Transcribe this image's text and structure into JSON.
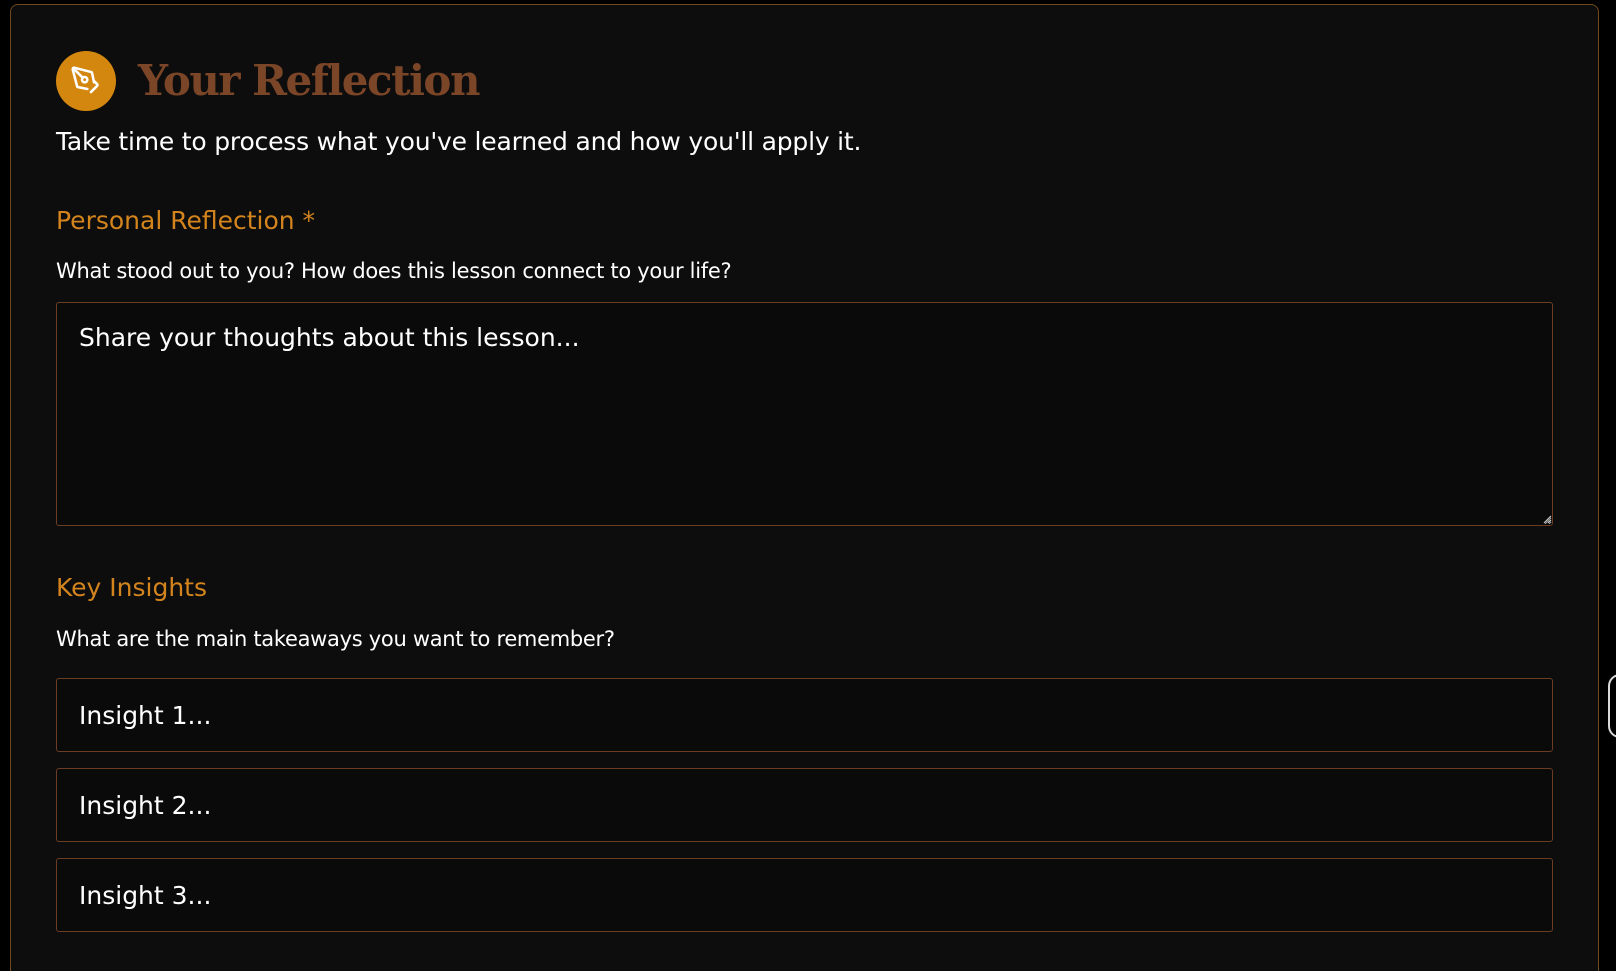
{
  "header": {
    "icon": "pen-nib-icon",
    "title": "Your Reflection",
    "subtitle": "Take time to process what you've learned and how you'll apply it."
  },
  "personal_reflection": {
    "label": "Personal Reflection *",
    "help": "What stood out to you? How does this lesson connect to your life?",
    "placeholder": "Share your thoughts about this lesson...",
    "value": ""
  },
  "key_insights": {
    "label": "Key Insights",
    "help": "What are the main takeaways you want to remember?",
    "inputs": [
      {
        "placeholder": "Insight 1...",
        "value": ""
      },
      {
        "placeholder": "Insight 2...",
        "value": ""
      },
      {
        "placeholder": "Insight 3...",
        "value": ""
      }
    ]
  },
  "colors": {
    "accent": "#d4870f",
    "title": "#7b4527",
    "label": "#d4841d",
    "border": "#6b3d22",
    "background": "#0d0d0d"
  }
}
